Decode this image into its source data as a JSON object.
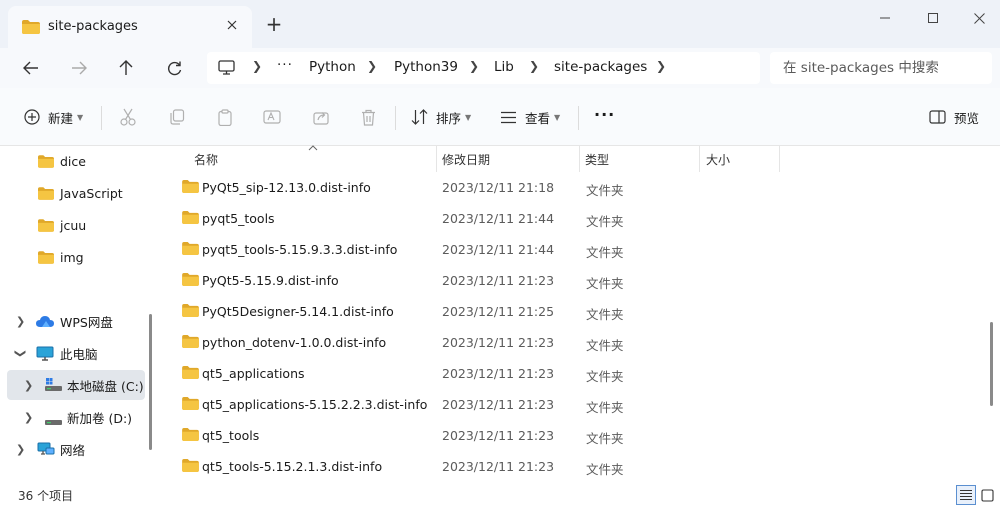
{
  "window": {
    "tab_title": "site-packages",
    "new_tab_glyph": "+",
    "minimize_glyph": "—",
    "close_glyph": "✕"
  },
  "nav": {
    "more_glyph": "···",
    "breadcrumb": [
      "Python",
      "Python39",
      "Lib",
      "site-packages"
    ],
    "search_placeholder": "在 site-packages 中搜索"
  },
  "toolbar": {
    "new_label": "新建",
    "sort_label": "排序",
    "view_label": "查看",
    "more_glyph": "···",
    "preview_label": "预览"
  },
  "sidebar": {
    "folders": [
      "dice",
      "JavaScript",
      "jcuu",
      "img"
    ],
    "wps_label": "WPS网盘",
    "pc_label": "此电脑",
    "drive_c_label": "本地磁盘 (C:)",
    "drive_d_label": "新加卷 (D:)",
    "network_label": "网络"
  },
  "columns": {
    "name": "名称",
    "modified": "修改日期",
    "type": "类型",
    "size": "大小"
  },
  "files": [
    {
      "name": "PyQt5_sip-12.13.0.dist-info",
      "date": "2023/12/11 21:18",
      "type": "文件夹"
    },
    {
      "name": "pyqt5_tools",
      "date": "2023/12/11 21:44",
      "type": "文件夹"
    },
    {
      "name": "pyqt5_tools-5.15.9.3.3.dist-info",
      "date": "2023/12/11 21:44",
      "type": "文件夹"
    },
    {
      "name": "PyQt5-5.15.9.dist-info",
      "date": "2023/12/11 21:23",
      "type": "文件夹"
    },
    {
      "name": "PyQt5Designer-5.14.1.dist-info",
      "date": "2023/12/11 21:25",
      "type": "文件夹"
    },
    {
      "name": "python_dotenv-1.0.0.dist-info",
      "date": "2023/12/11 21:23",
      "type": "文件夹"
    },
    {
      "name": "qt5_applications",
      "date": "2023/12/11 21:23",
      "type": "文件夹"
    },
    {
      "name": "qt5_applications-5.15.2.2.3.dist-info",
      "date": "2023/12/11 21:23",
      "type": "文件夹"
    },
    {
      "name": "qt5_tools",
      "date": "2023/12/11 21:23",
      "type": "文件夹"
    },
    {
      "name": "qt5_tools-5.15.2.1.3.dist-info",
      "date": "2023/12/11 21:23",
      "type": "文件夹"
    }
  ],
  "status": {
    "item_count": "36 个项目"
  },
  "colors": {
    "folder": "#f5c542",
    "folder_dark": "#e0a82a",
    "accent": "#0067c0"
  },
  "icons": [
    "folder-icon",
    "back-arrow-icon",
    "forward-arrow-icon",
    "up-arrow-icon",
    "refresh-icon",
    "computer-icon",
    "chevron-right-icon",
    "new-plus-icon",
    "cut-icon",
    "copy-icon",
    "paste-icon",
    "rename-icon",
    "share-icon",
    "delete-icon",
    "sort-icon",
    "view-icon",
    "preview-pane-icon",
    "cloud-icon",
    "drive-icon",
    "network-icon",
    "details-view-icon",
    "tiles-view-icon"
  ]
}
